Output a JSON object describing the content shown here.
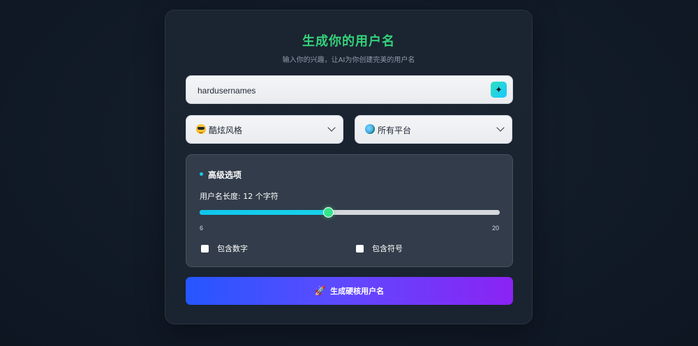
{
  "header": {
    "title": "生成你的用户名",
    "subtitle": "输入你的兴趣，让AI为你创建完美的用户名"
  },
  "keyword": {
    "value": "hardusernames",
    "magic_icon": "sparkle-wand-icon"
  },
  "style_select": {
    "icon": "cool-face-emoji",
    "selected": "酷炫风格"
  },
  "platform_select": {
    "icon": "globe-emoji",
    "selected": "所有平台"
  },
  "advanced": {
    "title": "高级选项",
    "length_label": "用户名长度: 12 个字符",
    "length": 12,
    "min": 6,
    "max": 20,
    "min_label": "6",
    "max_label": "20",
    "include_numbers": {
      "label": "包含数字",
      "checked": false
    },
    "include_symbols": {
      "label": "包含符号",
      "checked": false
    }
  },
  "generate": {
    "icon": "rocket-icon",
    "label": "生成硬核用户名"
  },
  "colors": {
    "title": "#34d27a",
    "accent": "#1fc6e6",
    "button_start": "#2556ff",
    "button_end": "#8a23f4"
  }
}
